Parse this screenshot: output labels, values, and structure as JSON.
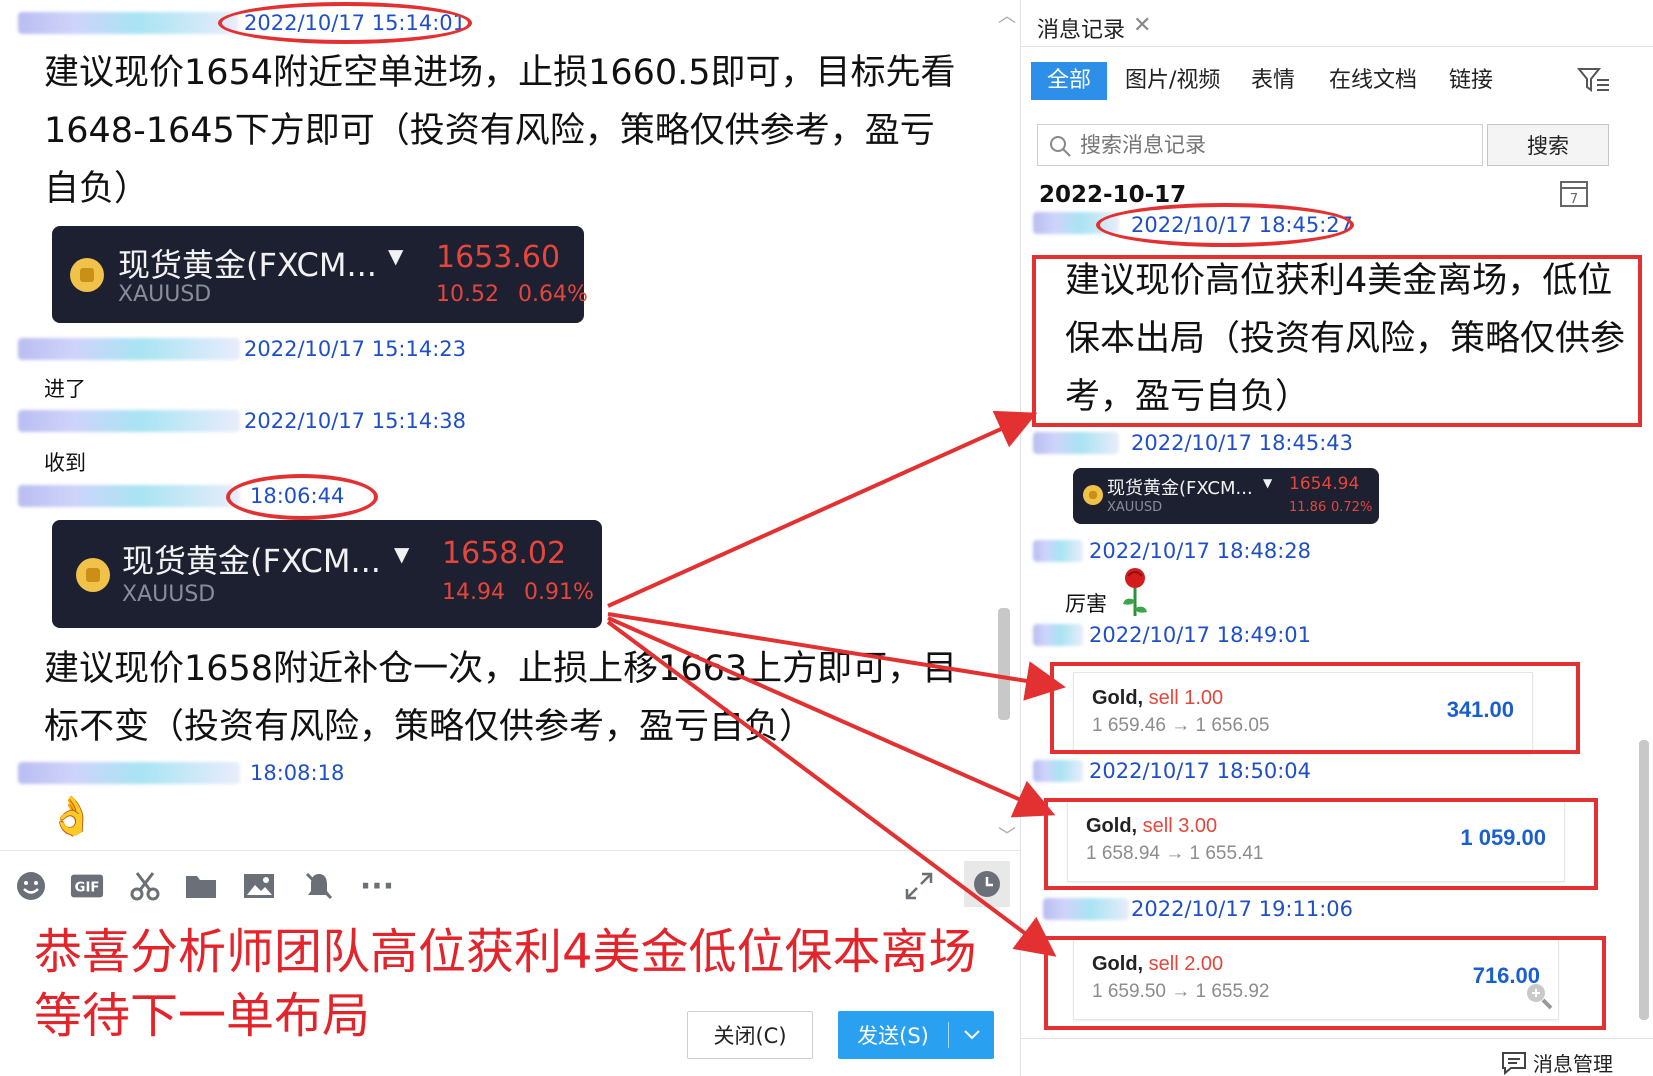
{
  "left": {
    "messages": [
      {
        "time": "2022/10/17 15:14:01",
        "text": "建议现价1654附近空单进场，止损1660.5即可，目标先看1648-1645下方即可（投资有风险，策略仅供参考，盈亏自负）"
      },
      {
        "time": "2022/10/17 15:14:23",
        "text": "进了"
      },
      {
        "time": "2022/10/17 15:14:38",
        "text": "收到"
      },
      {
        "time": "18:06:44",
        "text": "建议现价1658附近补仓一次，止损上移1663上方即可，目标不变（投资有风险，策略仅供参考，盈亏自负）"
      },
      {
        "time": "18:08:18",
        "text": ""
      }
    ],
    "tickers": [
      {
        "name": "现货黄金(FXCM...",
        "symbol": "XAUUSD",
        "price": "1653.60",
        "change": "10.52",
        "pct": "0.64%"
      },
      {
        "name": "现货黄金(FXCM...",
        "symbol": "XAUUSD",
        "price": "1658.02",
        "change": "14.94",
        "pct": "0.91%"
      }
    ],
    "overlay_text": [
      "恭喜分析师团队高位获利4美金低位保本离场",
      "等待下一单布局"
    ],
    "buttons": {
      "close": "关闭(C)",
      "send": "发送(S)"
    }
  },
  "right": {
    "tab_title": "消息记录",
    "filters": [
      "全部",
      "图片/视频",
      "表情",
      "在线文档",
      "链接"
    ],
    "search_placeholder": "搜索消息记录",
    "search_button": "搜索",
    "date": "2022-10-17",
    "messages": [
      {
        "time": "2022/10/17 18:45:27",
        "text": "建议现价高位获利4美金离场，低位保本出局（投资有风险，策略仅供参考，盈亏自负）"
      },
      {
        "time": "2022/10/17 18:45:43",
        "text": ""
      },
      {
        "time": "2022/10/17 18:48:28",
        "text": "厉害"
      },
      {
        "time": "2022/10/17 18:49:01",
        "text": ""
      },
      {
        "time": "2022/10/17 18:50:04",
        "text": ""
      },
      {
        "time": "2022/10/17 19:11:06",
        "text": ""
      }
    ],
    "ticker": {
      "name": "现货黄金(FXCM...",
      "symbol": "XAUUSD",
      "price": "1654.94",
      "change": "11.86",
      "pct": "0.72%"
    },
    "trades": [
      {
        "symbol": "Gold,",
        "side": "sell 1.00",
        "range": "1 659.46 → 1 656.05",
        "pnl": "341.00"
      },
      {
        "symbol": "Gold,",
        "side": "sell 3.00",
        "range": "1 658.94 → 1 655.41",
        "pnl": "1 059.00"
      },
      {
        "symbol": "Gold,",
        "side": "sell 2.00",
        "range": "1 659.50 → 1 655.92",
        "pnl": "716.00"
      }
    ],
    "footer": "消息管理"
  },
  "colors": {
    "accent": "#2e8fe8",
    "annotation": "#e33131",
    "timestamp": "#1f4fc7",
    "loss_red": "#e5463c",
    "pnl_blue": "#1a5fd0"
  }
}
